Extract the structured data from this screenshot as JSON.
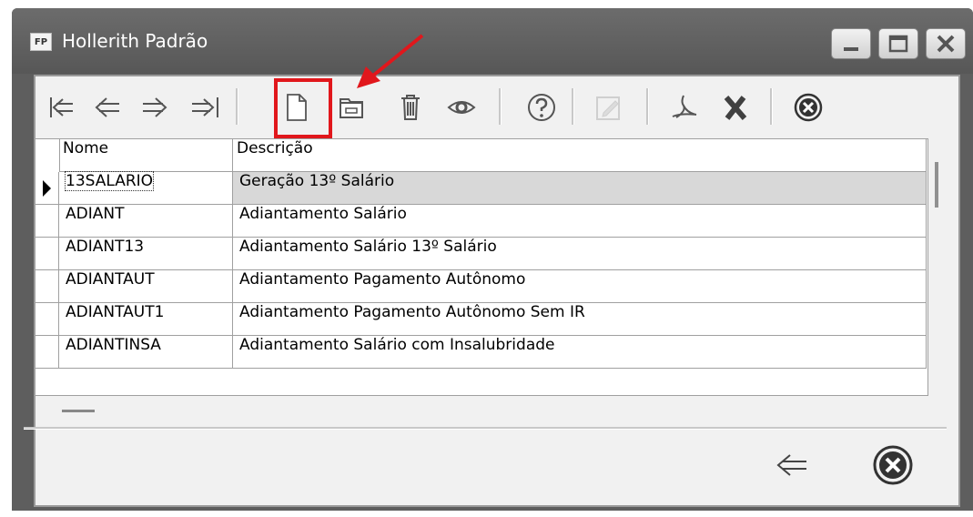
{
  "window": {
    "title": "Hollerith Padrão",
    "app_icon_text": "FP",
    "controls": [
      "minimize",
      "maximize",
      "close"
    ]
  },
  "toolbar": {
    "buttons": [
      {
        "name": "first-record",
        "icon": "first-arrow-icon"
      },
      {
        "name": "previous-record",
        "icon": "left-arrow-icon"
      },
      {
        "name": "next-record",
        "icon": "right-arrow-icon"
      },
      {
        "name": "last-record",
        "icon": "last-arrow-icon"
      },
      {
        "name": "new",
        "icon": "new-document-icon",
        "highlighted": true
      },
      {
        "name": "open",
        "icon": "folder-icon"
      },
      {
        "name": "delete",
        "icon": "trash-icon"
      },
      {
        "name": "view",
        "icon": "eye-icon"
      },
      {
        "name": "help",
        "icon": "help-icon"
      },
      {
        "name": "edit",
        "icon": "edit-icon",
        "disabled": true
      },
      {
        "name": "export-pdf",
        "icon": "pdf-icon"
      },
      {
        "name": "export-excel",
        "icon": "excel-x-icon"
      },
      {
        "name": "close",
        "icon": "close-circle-icon"
      }
    ]
  },
  "grid": {
    "columns": [
      "Nome",
      "Descrição"
    ],
    "rows": [
      {
        "nome": "13SALARIO",
        "descricao": "Geração 13º Salário",
        "selected": true
      },
      {
        "nome": "ADIANT",
        "descricao": "Adiantamento Salário"
      },
      {
        "nome": "ADIANT13",
        "descricao": "Adiantamento Salário 13º Salário"
      },
      {
        "nome": "ADIANTAUT",
        "descricao": "Adiantamento Pagamento Autônomo"
      },
      {
        "nome": "ADIANTAUT1",
        "descricao": "Adiantamento Pagamento Autônomo Sem IR"
      },
      {
        "nome": "ADIANTINSA",
        "descricao": "Adiantamento Salário com Insalubridade"
      }
    ]
  },
  "footer": {
    "buttons": [
      {
        "name": "back",
        "icon": "back-arrow-icon"
      },
      {
        "name": "cancel",
        "icon": "close-circle-icon"
      }
    ]
  },
  "colors": {
    "highlight": "#e1171c",
    "titlebar": "#5e5e5e",
    "client": "#f1f1f1",
    "selected_row": "#d8d8d8"
  }
}
